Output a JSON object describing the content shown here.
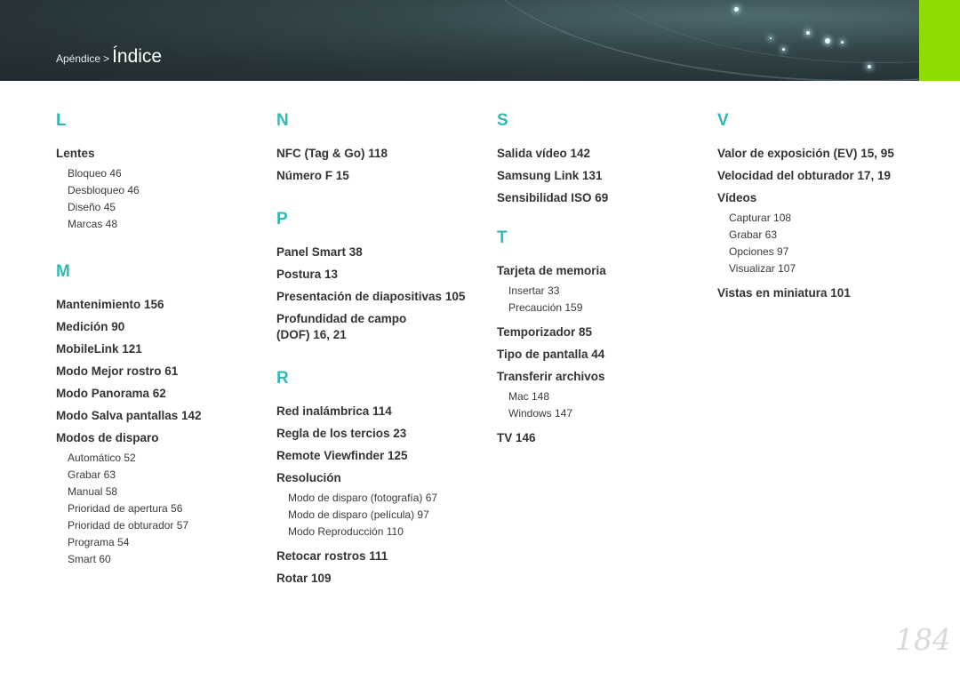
{
  "header": {
    "breadcrumb_parent": "Apéndice",
    "breadcrumb_sep": ">",
    "breadcrumb_current": "Índice",
    "accent_color": "#8fdc00"
  },
  "index": {
    "L": {
      "letter": "L",
      "entries": [
        {
          "label": "Lentes",
          "subs": [
            "Bloqueo  46",
            "Desbloqueo  46",
            "Diseño  45",
            "Marcas  48"
          ]
        }
      ]
    },
    "M": {
      "letter": "M",
      "entries": [
        {
          "label": "Mantenimiento  156"
        },
        {
          "label": "Medición  90"
        },
        {
          "label": "MobileLink  121"
        },
        {
          "label": "Modo Mejor rostro  61"
        },
        {
          "label": "Modo Panorama  62"
        },
        {
          "label": "Modo Salva pantallas  142"
        },
        {
          "label": "Modos de disparo",
          "subs": [
            "Automático  52",
            "Grabar  63",
            "Manual  58",
            "Prioridad de apertura  56",
            "Prioridad de obturador  57",
            "Programa  54",
            "Smart  60"
          ]
        }
      ]
    },
    "N": {
      "letter": "N",
      "entries": [
        {
          "label": "NFC (Tag & Go)  118"
        },
        {
          "label": "Número F  15"
        }
      ]
    },
    "P": {
      "letter": "P",
      "entries": [
        {
          "label": "Panel Smart  38"
        },
        {
          "label": "Postura  13"
        },
        {
          "label": "Presentación de diapositivas  105"
        },
        {
          "label": "Profundidad de campo",
          "label2": "(DOF)  16, 21"
        }
      ]
    },
    "R": {
      "letter": "R",
      "entries": [
        {
          "label": "Red inalámbrica  114"
        },
        {
          "label": "Regla de los tercios  23"
        },
        {
          "label": "Remote Viewfinder  125"
        },
        {
          "label": "Resolución",
          "subs": [
            "Modo de disparo (fotografía)  67",
            "Modo de disparo (película)  97",
            "Modo Reproducción  110"
          ]
        },
        {
          "label": "Retocar rostros  111"
        },
        {
          "label": "Rotar  109"
        }
      ]
    },
    "S": {
      "letter": "S",
      "entries": [
        {
          "label": "Salida vídeo  142"
        },
        {
          "label": "Samsung Link  131"
        },
        {
          "label": "Sensibilidad ISO  69"
        }
      ]
    },
    "T": {
      "letter": "T",
      "entries": [
        {
          "label": "Tarjeta de memoria",
          "subs": [
            "Insertar  33",
            "Precaución  159"
          ]
        },
        {
          "label": "Temporizador  85"
        },
        {
          "label": "Tipo de pantalla  44"
        },
        {
          "label": "Transferir archivos",
          "subs": [
            "Mac  148",
            "Windows  147"
          ]
        },
        {
          "label": "TV  146"
        }
      ]
    },
    "V": {
      "letter": "V",
      "entries": [
        {
          "label": "Valor de exposición (EV)  15, 95"
        },
        {
          "label": "Velocidad del obturador  17, 19"
        },
        {
          "label": "Vídeos",
          "subs": [
            "Capturar  108",
            "Grabar  63",
            "Opciones  97",
            "Visualizar  107"
          ]
        },
        {
          "label": "Vistas en miniatura  101"
        }
      ]
    }
  },
  "page_number": "184"
}
